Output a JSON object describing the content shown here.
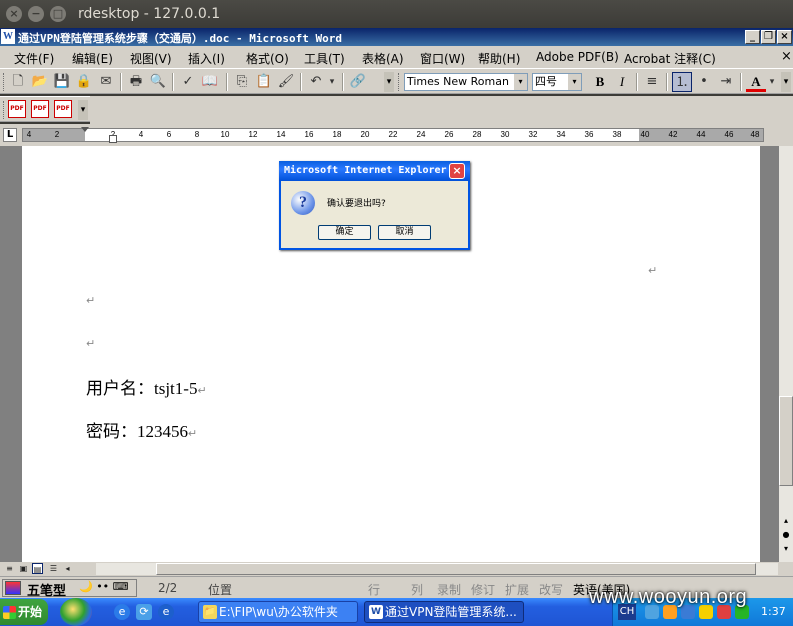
{
  "outer_window": {
    "title": "rdesktop - 127.0.0.1",
    "close_glyph": "×",
    "min_glyph": "−",
    "max_glyph": "□"
  },
  "word_window": {
    "title": "通过VPN登陆管理系统步骤（交通局）.doc - Microsoft Word",
    "icon_glyph": "W",
    "min_glyph": "_",
    "restore_glyph": "❐",
    "close_glyph": "×",
    "doc_close_glyph": "×"
  },
  "menu": [
    {
      "label": "文件(F)"
    },
    {
      "label": "编辑(E)"
    },
    {
      "label": "视图(V)"
    },
    {
      "label": "插入(I)"
    },
    {
      "label": "格式(O)"
    },
    {
      "label": "工具(T)"
    },
    {
      "label": "表格(A)"
    },
    {
      "label": "窗口(W)"
    },
    {
      "label": "帮助(H)"
    },
    {
      "label": "Adobe PDF(B)"
    },
    {
      "label": "Acrobat 注释(C)"
    }
  ],
  "toolbar": {
    "font_name": "Times New Roman",
    "font_size": "四号",
    "bold": "B",
    "italic": "I",
    "dropdown_glyph": "▾",
    "font_color_glyph": "A",
    "buttons": {
      "new": "🗋",
      "open": "📂",
      "save": "💾",
      "permission": "🔒",
      "email": "✉",
      "print": "🖶",
      "preview": "🔍",
      "spell": "✓",
      "research": "📖",
      "copy": "⎘",
      "paste": "📋",
      "format_painter": "🖌",
      "undo": "↶",
      "hyperlink": "🔗",
      "align": "≡",
      "numbering": "⒈",
      "bullets": "•",
      "indent": "⇥"
    }
  },
  "pdf_toolbar": {
    "icons": [
      "PDF",
      "PDF",
      "PDF"
    ]
  },
  "ruler": {
    "box_glyph": "L",
    "ticks": [
      "4",
      "2",
      "2",
      "4",
      "6",
      "8",
      "10",
      "12",
      "14",
      "16",
      "18",
      "20",
      "22",
      "24",
      "26",
      "28",
      "30",
      "32",
      "34",
      "36",
      "38",
      "40",
      "42",
      "44",
      "46",
      "48"
    ]
  },
  "document": {
    "paragraph_mark": "↵",
    "username_line": "用户名：tsjt1-5",
    "password_line": "密码：123456"
  },
  "dialog": {
    "title": "Microsoft Internet Explorer",
    "close_glyph": "×",
    "icon_glyph": "?",
    "message": "确认要退出吗?",
    "ok_label": "确定",
    "cancel_label": "取消"
  },
  "view_buttons": [
    "≡",
    "▣",
    "▤",
    "☰",
    "◂"
  ],
  "statusbar": {
    "ime": "五笔型",
    "ime_extra": "🌙 •• ⌨",
    "page": "2/2",
    "position": "位置",
    "col": "行",
    "row": "列",
    "rec": "录制",
    "trk": "修订",
    "ext": "扩展",
    "ovr": "改写",
    "language": "英语(美国)"
  },
  "taskbar": {
    "start_label": "开始",
    "quick_launch": [
      "e",
      "⟳",
      "e"
    ],
    "tasks": [
      {
        "label": "E:\\FIP\\wu\\办公软件夹",
        "icon": "📁"
      },
      {
        "label": "通过VPN登陆管理系统...",
        "icon": "W"
      }
    ],
    "tray_ime": "CH",
    "time": "1:37"
  },
  "watermark": "www.wooyun.org"
}
